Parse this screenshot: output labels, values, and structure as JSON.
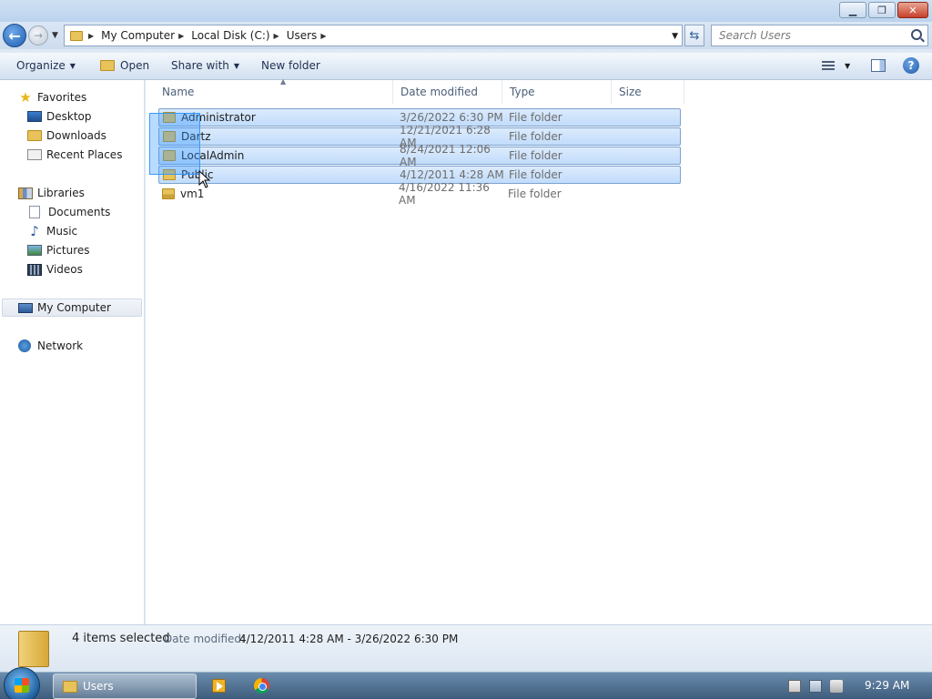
{
  "window": {
    "minimize": "▁",
    "maximize": "❐",
    "close": "✕"
  },
  "address": {
    "breadcrumbs": [
      "My Computer",
      "Local Disk (C:)",
      "Users"
    ],
    "search_placeholder": "Search Users"
  },
  "toolbar": {
    "organize": "Organize",
    "open": "Open",
    "share_with": "Share with",
    "new_folder": "New folder"
  },
  "nav": {
    "favorites": "Favorites",
    "favorites_items": [
      "Desktop",
      "Downloads",
      "Recent Places"
    ],
    "libraries": "Libraries",
    "libraries_items": [
      "Documents",
      "Music",
      "Pictures",
      "Videos"
    ],
    "computer": "My Computer",
    "network": "Network"
  },
  "columns": {
    "name": "Name",
    "date_modified": "Date modified",
    "type": "Type",
    "size": "Size"
  },
  "files": [
    {
      "name": "Administrator",
      "date": "3/26/2022 6:30 PM",
      "type": "File folder",
      "selected": true
    },
    {
      "name": "Dartz",
      "date": "12/21/2021 6:28 AM",
      "type": "File folder",
      "selected": true
    },
    {
      "name": "LocalAdmin",
      "date": "8/24/2021 12:06 AM",
      "type": "File folder",
      "selected": true
    },
    {
      "name": "Public",
      "date": "4/12/2011 4:28 AM",
      "type": "File folder",
      "selected": true
    },
    {
      "name": "vm1",
      "date": "4/16/2022 11:36 AM",
      "type": "File folder",
      "selected": false
    }
  ],
  "details": {
    "count": "4 items selected",
    "date_label": "Date modified:",
    "date_value": "4/12/2011 4:28 AM - 3/26/2022 6:30 PM"
  },
  "taskbar": {
    "task_label": "Users",
    "clock": "9:29 AM"
  }
}
